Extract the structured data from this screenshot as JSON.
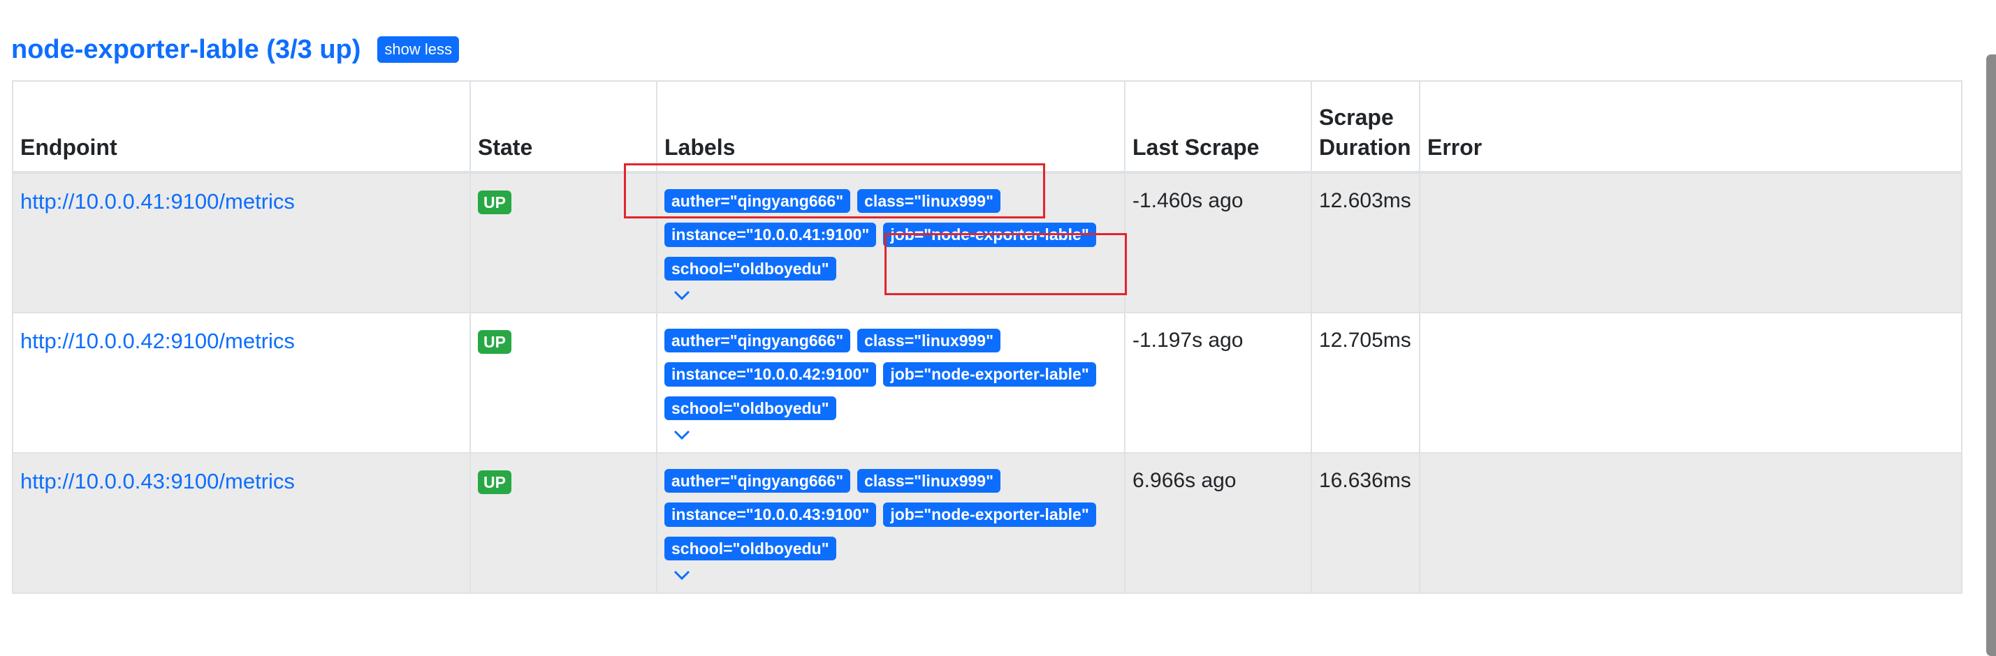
{
  "job": {
    "title": "node-exporter-lable (3/3 up)",
    "toggle_label": "show less"
  },
  "table": {
    "columns": [
      "Endpoint",
      "State",
      "Labels",
      "Last Scrape",
      "Scrape Duration",
      "Error"
    ],
    "rows": [
      {
        "endpoint": "http://10.0.0.41:9100/metrics",
        "state": "UP",
        "labels": [
          "auther=\"qingyang666\"",
          "class=\"linux999\"",
          "instance=\"10.0.0.41:9100\"",
          "job=\"node-exporter-lable\"",
          "school=\"oldboyedu\""
        ],
        "last_scrape": "-1.460s ago",
        "duration": "12.603ms",
        "error": ""
      },
      {
        "endpoint": "http://10.0.0.42:9100/metrics",
        "state": "UP",
        "labels": [
          "auther=\"qingyang666\"",
          "class=\"linux999\"",
          "instance=\"10.0.0.42:9100\"",
          "job=\"node-exporter-lable\"",
          "school=\"oldboyedu\""
        ],
        "last_scrape": "-1.197s ago",
        "duration": "12.705ms",
        "error": ""
      },
      {
        "endpoint": "http://10.0.0.43:9100/metrics",
        "state": "UP",
        "labels": [
          "auther=\"qingyang666\"",
          "class=\"linux999\"",
          "instance=\"10.0.0.43:9100\"",
          "job=\"node-exporter-lable\"",
          "school=\"oldboyedu\""
        ],
        "last_scrape": "6.966s ago",
        "duration": "16.636ms",
        "error": ""
      }
    ]
  },
  "colors": {
    "accent": "#0d6efd",
    "state_up": "#28a745",
    "annotation": "#e3242b"
  },
  "icons": {
    "expand": "chevron-down-icon"
  }
}
